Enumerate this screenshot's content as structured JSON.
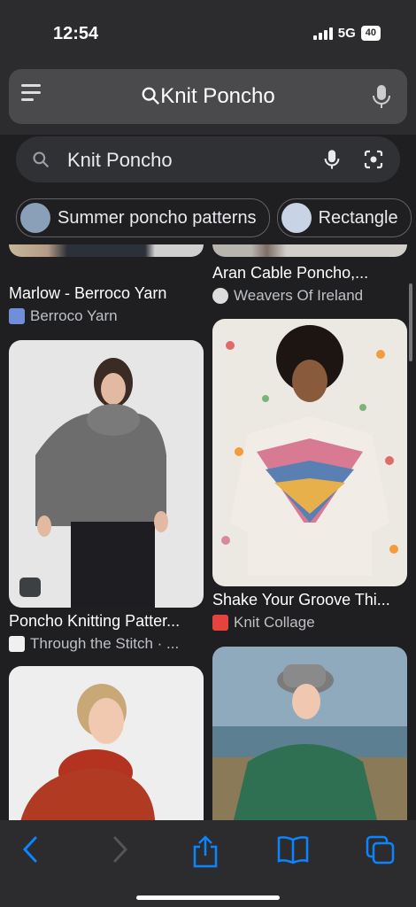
{
  "status": {
    "time": "12:54",
    "network": "5G",
    "battery": "40"
  },
  "safari": {
    "address_text": "Knit Poncho"
  },
  "search": {
    "query": "Knit Poncho"
  },
  "chips": [
    {
      "label": "Summer poncho patterns"
    },
    {
      "label": "Rectangle"
    }
  ],
  "results": [
    {
      "title": "Marlow - Berroco Yarn",
      "source": "Berroco Yarn"
    },
    {
      "title": "Aran Cable Poncho,...",
      "source": "Weavers Of Ireland"
    },
    {
      "title": "Poncho Knitting Patter...",
      "source": "Through the Stitch · ..."
    },
    {
      "title": "Shake Your Groove Thi...",
      "source": "Knit Collage"
    }
  ],
  "colors": {
    "link_blue": "#0a84ff",
    "background": "#1f1f21"
  }
}
